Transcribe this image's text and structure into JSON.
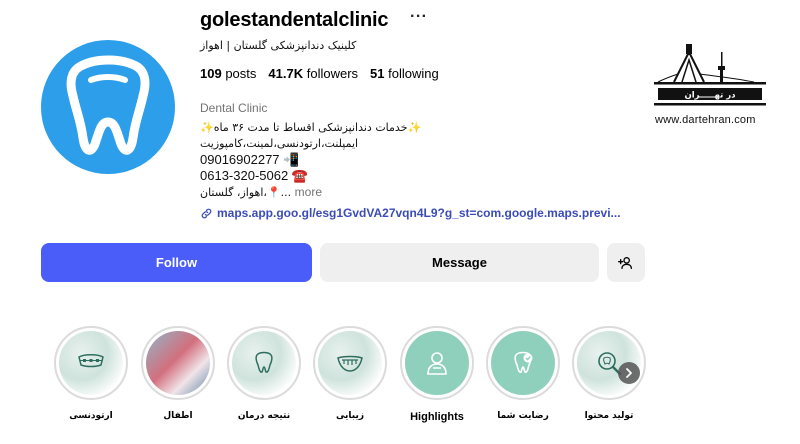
{
  "profile": {
    "username": "golestandentalclinic",
    "more_label": "···",
    "full_name": "کلینیک دندانپزشکی گلستان | اهواز",
    "posts_count": "109",
    "posts_label": "posts",
    "followers_count": "41.7K",
    "followers_label": "followers",
    "following_count": "51",
    "following_label": "following",
    "category": "Dental Clinic",
    "bio_lines": [
      "✨خدمات دندانپزشکی اقساط تا مدت ۳۶ ماه✨",
      "ایمپلنت،ارتودنسی،لمینت،کامپوزیت",
      "09016902277 📲",
      "0613-320-5062 ☎️",
      "اهواز، گلستان،📍..."
    ],
    "bio_more": "more",
    "link": "maps.app.goo.gl/esg1GvdVA27vqn4L9?g_st=com.google.maps.previ..."
  },
  "buttons": {
    "follow": "Follow",
    "message": "Message"
  },
  "highlights": [
    {
      "label": "ارتودنسی",
      "icon": "braces-icon"
    },
    {
      "label": "اطفال",
      "icon": "photo"
    },
    {
      "label": "نتیجه درمان",
      "icon": "tooth-icon"
    },
    {
      "label": "زیبایی",
      "icon": "smile-icon"
    },
    {
      "label": "Highlights",
      "icon": "dentist-icon"
    },
    {
      "label": "رضایت شما",
      "icon": "tooth-check-icon"
    },
    {
      "label": "تولید محتوا",
      "icon": "magnifier-tooth-icon"
    }
  ],
  "watermark": {
    "logo_text": "در تهـــــران",
    "site": "www.dartehran.com"
  },
  "colors": {
    "follow_button": "#4a5df9",
    "link": "#3b4cb8",
    "avatar_bg": "#2d9ee9"
  }
}
